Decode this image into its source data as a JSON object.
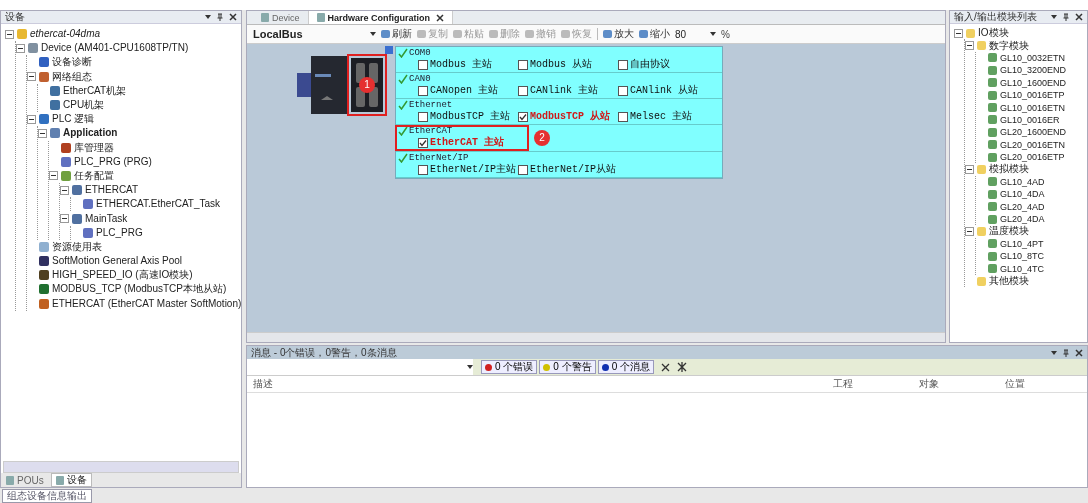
{
  "left_panel": {
    "title": "设备",
    "tree": [
      {
        "label": "ethercat-04dma",
        "kind": "project",
        "expanded": true,
        "children": [
          {
            "label": "Device (AM401-CPU1608TP/TN)",
            "kind": "device",
            "expanded": true,
            "children": [
              {
                "label": "设备诊断",
                "kind": "diag"
              },
              {
                "label": "网络组态",
                "kind": "network",
                "expanded": true,
                "children": [
                  {
                    "label": "EtherCAT机架",
                    "kind": "rack"
                  },
                  {
                    "label": "CPU机架",
                    "kind": "rack"
                  }
                ]
              },
              {
                "label": "PLC 逻辑",
                "kind": "plc",
                "expanded": true,
                "children": [
                  {
                    "label": "Application",
                    "kind": "app",
                    "expanded": true,
                    "children": [
                      {
                        "label": "库管理器",
                        "kind": "library"
                      },
                      {
                        "label": "PLC_PRG (PRG)",
                        "kind": "pou"
                      },
                      {
                        "label": "任务配置",
                        "kind": "tasks",
                        "expanded": true,
                        "children": [
                          {
                            "label": "ETHERCAT",
                            "kind": "task",
                            "expanded": true,
                            "children": [
                              {
                                "label": "ETHERCAT.EtherCAT_Task",
                                "kind": "pou"
                              }
                            ]
                          },
                          {
                            "label": "MainTask",
                            "kind": "task",
                            "expanded": true,
                            "children": [
                              {
                                "label": "PLC_PRG",
                                "kind": "pou"
                              }
                            ]
                          }
                        ]
                      }
                    ]
                  }
                ]
              },
              {
                "label": "资源使用表",
                "kind": "resource"
              },
              {
                "label": "SoftMotion General Axis Pool",
                "kind": "axis"
              },
              {
                "label": "HIGH_SPEED_IO (高速IO模块)",
                "kind": "hsio"
              },
              {
                "label": "MODBUS_TCP (ModbusTCP本地从站)",
                "kind": "modbus"
              },
              {
                "label": "ETHERCAT (EtherCAT Master SoftMotion)",
                "kind": "ecat"
              }
            ]
          }
        ]
      }
    ],
    "tabs": [
      {
        "label": "POUs",
        "selected": false
      },
      {
        "label": "设备",
        "selected": true
      }
    ]
  },
  "editor": {
    "tabs": [
      {
        "label": "Device",
        "selected": false
      },
      {
        "label": "Hardware Configuration",
        "selected": true
      }
    ],
    "bus": "LocalBus",
    "toolbar": [
      {
        "label": "刷新",
        "disabled": false
      },
      {
        "label": "复制",
        "disabled": true
      },
      {
        "label": "粘贴",
        "disabled": true
      },
      {
        "label": "删除",
        "disabled": true
      },
      {
        "label": "撤销",
        "disabled": true
      },
      {
        "label": "恢复",
        "disabled": true
      },
      {
        "label": "放大",
        "disabled": false
      },
      {
        "label": "缩小",
        "disabled": false
      }
    ],
    "zoom": "80",
    "zoom_unit": "%",
    "device_marker": "1",
    "groups": [
      {
        "name": "COM0",
        "options": [
          {
            "label": "Modbus 主站",
            "checked": false
          },
          {
            "label": "Modbus 从站",
            "checked": false
          },
          {
            "label": "自由协议",
            "checked": false
          }
        ]
      },
      {
        "name": "CAN0",
        "options": [
          {
            "label": "CANopen 主站",
            "checked": false
          },
          {
            "label": "CANlink 主站",
            "checked": false
          },
          {
            "label": "CANlink 从站",
            "checked": false
          }
        ]
      },
      {
        "name": "Ethernet",
        "options": [
          {
            "label": "ModbusTCP 主站",
            "checked": false
          },
          {
            "label": "ModbusTCP 从站",
            "checked": true
          },
          {
            "label": "Melsec 主站",
            "checked": false
          }
        ]
      },
      {
        "name": "EtherCAT",
        "marker": "2",
        "options": [
          {
            "label": "EtherCAT 主站",
            "checked": true
          }
        ]
      },
      {
        "name": "EtherNet/IP",
        "options": [
          {
            "label": "EtherNet/IP主站",
            "checked": false
          },
          {
            "label": "EtherNet/IP从站",
            "checked": false
          }
        ]
      }
    ]
  },
  "right_panel": {
    "title": "输入/输出模块列表",
    "tree": [
      {
        "label": "IO模块",
        "kind": "folder",
        "expanded": true,
        "children": [
          {
            "label": "数字模块",
            "kind": "folder",
            "expanded": true,
            "children": [
              {
                "label": "GL10_0032ETN",
                "kind": "module"
              },
              {
                "label": "GL10_3200END",
                "kind": "module"
              },
              {
                "label": "GL10_1600END",
                "kind": "module"
              },
              {
                "label": "GL10_0016ETP",
                "kind": "module"
              },
              {
                "label": "GL10_0016ETN",
                "kind": "module"
              },
              {
                "label": "GL10_0016ER",
                "kind": "module"
              },
              {
                "label": "GL20_1600END",
                "kind": "module"
              },
              {
                "label": "GL20_0016ETN",
                "kind": "module"
              },
              {
                "label": "GL20_0016ETP",
                "kind": "module"
              }
            ]
          },
          {
            "label": "模拟模块",
            "kind": "folder",
            "expanded": true,
            "children": [
              {
                "label": "GL10_4AD",
                "kind": "module"
              },
              {
                "label": "GL10_4DA",
                "kind": "module"
              },
              {
                "label": "GL20_4AD",
                "kind": "module"
              },
              {
                "label": "GL20_4DA",
                "kind": "module"
              }
            ]
          },
          {
            "label": "温度模块",
            "kind": "folder",
            "expanded": true,
            "children": [
              {
                "label": "GL10_4PT",
                "kind": "module"
              },
              {
                "label": "GL10_8TC",
                "kind": "module"
              },
              {
                "label": "GL10_4TC",
                "kind": "module"
              }
            ]
          },
          {
            "label": "其他模块",
            "kind": "folder"
          }
        ]
      }
    ]
  },
  "messages": {
    "title": "消息 - 0个错误，0警告，0条消息",
    "filters": [
      {
        "kind": "error",
        "label": "0 个错误"
      },
      {
        "kind": "warning",
        "label": "0 个警告"
      },
      {
        "kind": "info",
        "label": "0 个消息"
      }
    ],
    "columns": [
      "描述",
      "工程",
      "对象",
      "位置"
    ]
  },
  "status_bar": {
    "label": "组态设备信息输出"
  }
}
